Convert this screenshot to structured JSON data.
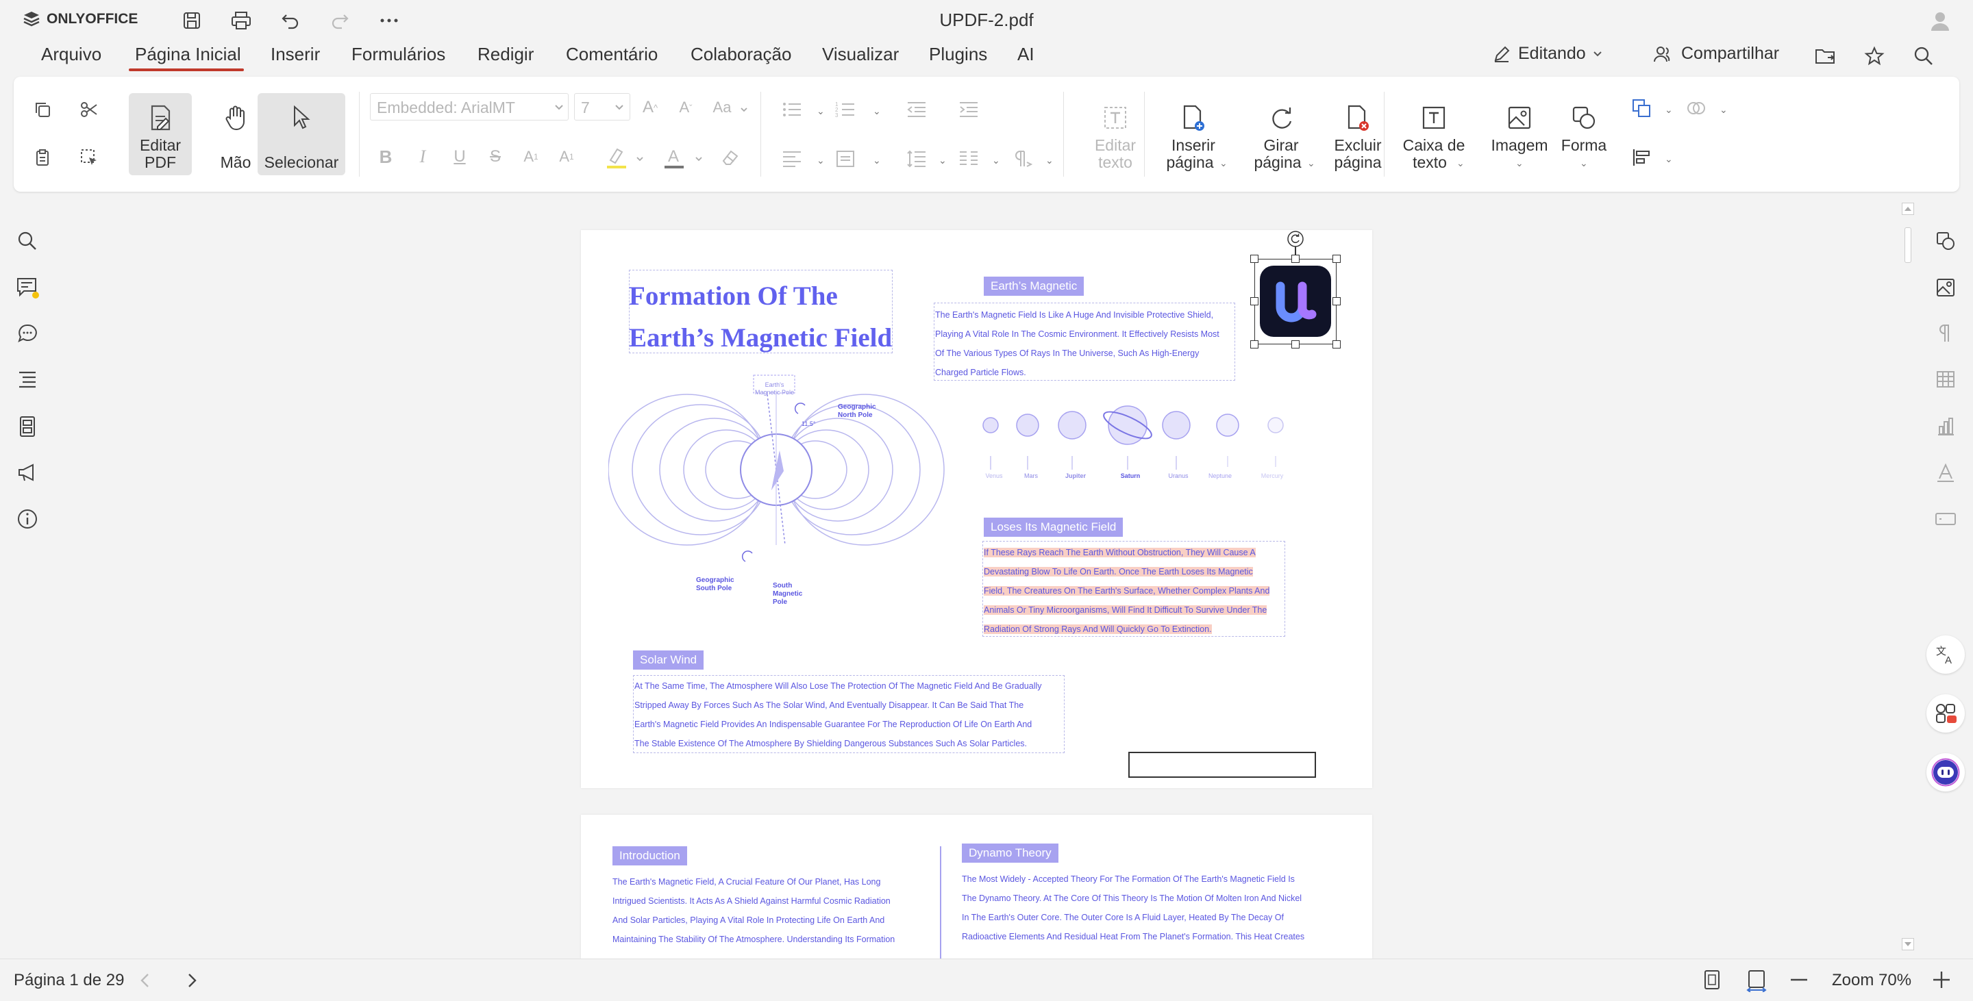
{
  "app": {
    "name": "ONLYOFFICE",
    "doc_title": "UPDF-2.pdf"
  },
  "menu": {
    "items": [
      "Arquivo",
      "Página Inicial",
      "Inserir",
      "Formulários",
      "Redigir",
      "Comentário",
      "Colaboração",
      "Visualizar",
      "Plugins",
      "AI"
    ],
    "active": "Página Inicial",
    "editing_label": "Editando",
    "share_label": "Compartilhar"
  },
  "ribbon": {
    "edit_pdf": [
      "Editar",
      "PDF"
    ],
    "hand": "Mão",
    "select": "Selecionar",
    "font_name": "Embedded: ArialMT",
    "font_size": "7",
    "edit_text": [
      "Editar",
      "texto"
    ],
    "insert_page": [
      "Inserir",
      "página"
    ],
    "rotate_page": [
      "Girar",
      "página"
    ],
    "delete_page": [
      "Excluir",
      "página"
    ],
    "text_box": [
      "Caixa de",
      "texto"
    ],
    "image": "Imagem",
    "shape": "Forma",
    "accent_color": "#c0392b"
  },
  "document": {
    "page1": {
      "title_line1": "Formation Of The",
      "title_line2": "Earth’s Magnetic Field",
      "tag_magnetic": "Earth’s Magnetic",
      "magnetic_text": [
        "The Earth's Magnetic Field Is Like A Huge And Invisible Protective Shield,",
        "Playing A Vital Role In The Cosmic Environment. It Effectively Resists Most",
        "Of The Various Types Of Rays In The Universe, Such As High-Energy",
        "Charged Particle Flows."
      ],
      "diagram_labels": {
        "earth_pole": [
          "Earth's",
          "Magnetic Pole"
        ],
        "geo_north": [
          "Geographic",
          "North Pole"
        ],
        "angle": "11.5°",
        "geo_south": [
          "Geographic",
          "South Pole"
        ],
        "south_mag": [
          "South",
          "Magnetic",
          "Pole"
        ]
      },
      "planets": [
        "Venus",
        "Mars",
        "Jupiter",
        "Saturn",
        "Uranus",
        "Neptune",
        "Mercury"
      ],
      "tag_loses": "Loses Its Magnetic Field",
      "loses_text": [
        "If These Rays Reach The Earth Without Obstruction, They Will Cause A",
        "Devastating Blow To Life On Earth. Once The Earth Loses Its Magnetic",
        "Field, The Creatures On The Earth's Surface, Whether Complex Plants And",
        "Animals Or Tiny Microorganisms, Will Find It Difficult To Survive Under The",
        "Radiation Of Strong Rays And Will Quickly Go To Extinction."
      ],
      "tag_solar": "Solar Wind",
      "solar_text": [
        "At The Same Time, The Atmosphere Will Also Lose The Protection Of The Magnetic Field And Be Gradually",
        "Stripped Away By Forces Such As The Solar Wind, And Eventually Disappear. It Can Be Said That The",
        "Earth's Magnetic Field Provides An Indispensable Guarantee For The Reproduction Of Life On Earth And",
        "The Stable Existence Of The Atmosphere By Shielding Dangerous Substances Such As Solar Particles."
      ]
    },
    "page2": {
      "tag_intro": "Introduction",
      "intro_text": [
        "The Earth's Magnetic Field, A Crucial Feature Of Our Planet, Has Long",
        "Intrigued Scientists. It Acts As A Shield Against Harmful Cosmic Radiation",
        "And Solar Particles, Playing A Vital Role In Protecting Life On Earth And",
        "Maintaining The Stability Of The Atmosphere. Understanding Its Formation"
      ],
      "tag_dynamo": "Dynamo Theory",
      "dynamo_text": [
        "The Most Widely - Accepted Theory For The Formation Of The Earth's Magnetic Field Is",
        "The Dynamo Theory. At The Core Of This Theory Is The Motion Of Molten Iron And Nickel",
        "In The Earth's Outer Core. The Outer Core Is A Fluid Layer, Heated By The Decay Of",
        "Radioactive Elements And Residual Heat From The Planet's Formation. This Heat Creates"
      ]
    }
  },
  "status": {
    "page_info": "Página 1 de 29",
    "zoom": "Zoom 70%"
  }
}
